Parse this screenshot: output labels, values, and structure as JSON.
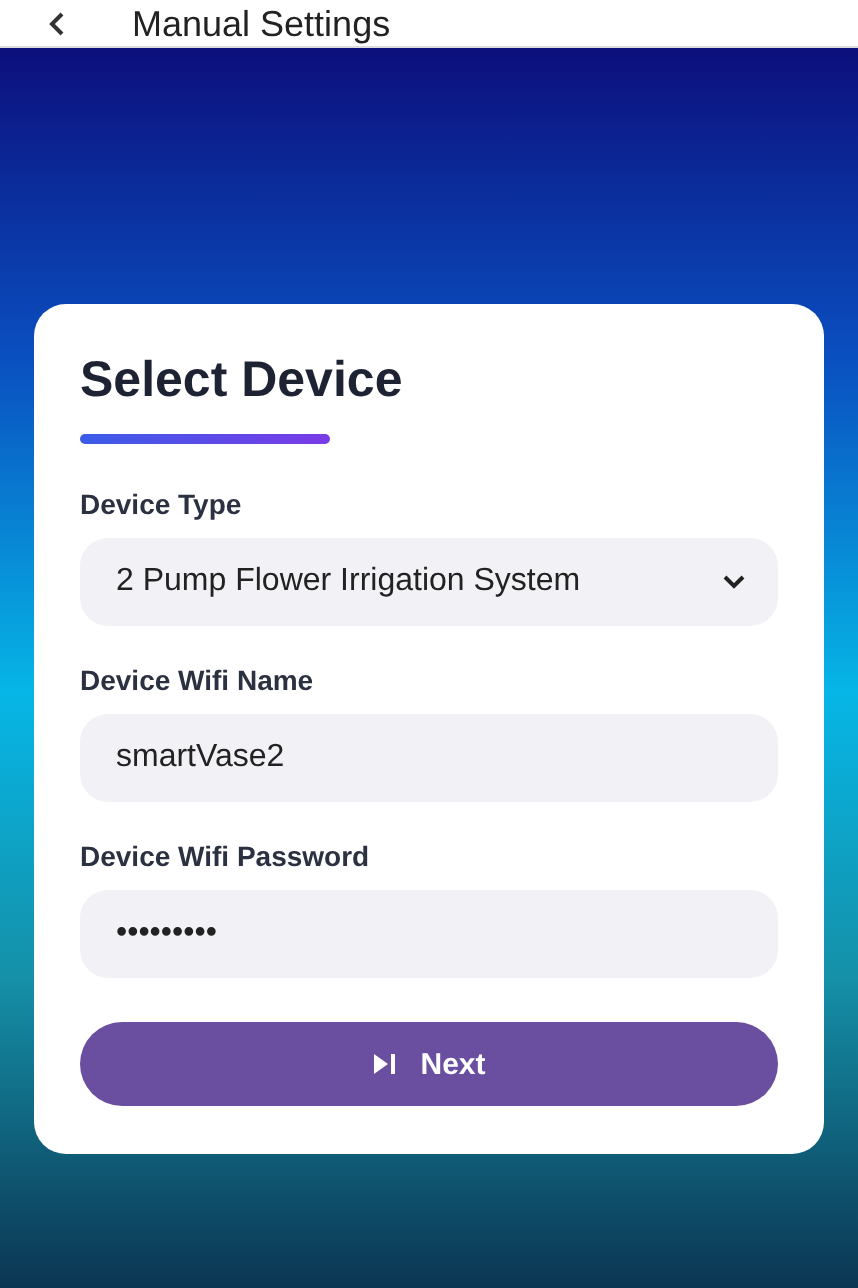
{
  "app_bar": {
    "title": "Manual Settings"
  },
  "card": {
    "title": "Select Device",
    "fields": [
      {
        "kind": "dropdown",
        "label": "Device Type",
        "value": "2 Pump Flower Irrigation System"
      },
      {
        "kind": "text",
        "label": "Device Wifi Name",
        "value": "smartVase2"
      },
      {
        "kind": "text",
        "label": "Device Wifi Password",
        "value": "•••••••••"
      }
    ],
    "button": {
      "label": "Next"
    }
  }
}
